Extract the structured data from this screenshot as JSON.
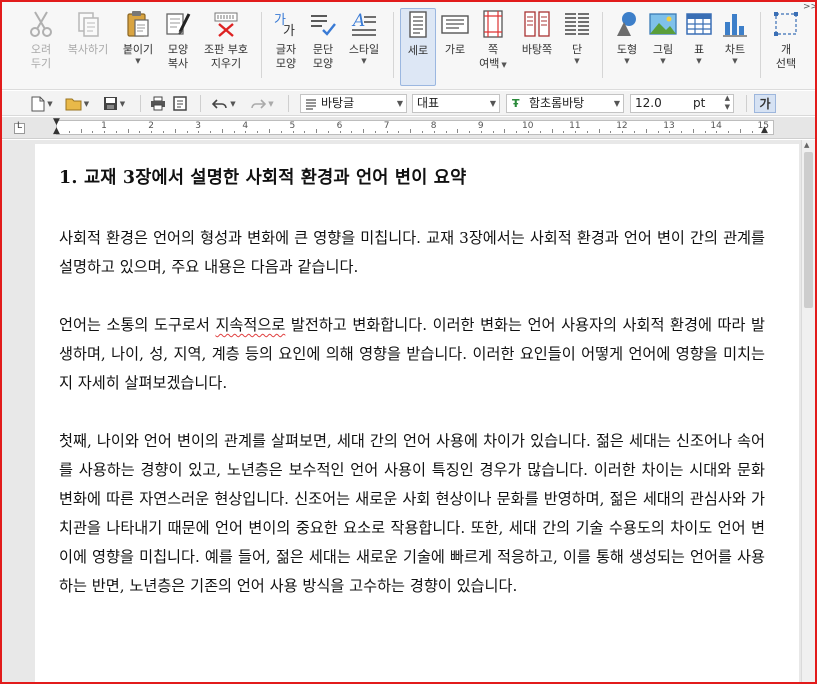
{
  "ribbon": {
    "cut": {
      "line1": "오려",
      "line2": "두기"
    },
    "copy": {
      "label": "복사하기"
    },
    "paste": {
      "label": "붙이기"
    },
    "format_copy": {
      "line1": "모양",
      "line2": "복사"
    },
    "clear_format": {
      "line1": "조판 부호",
      "line2": "지우기"
    },
    "char_shape": {
      "line1": "글자",
      "line2": "모양"
    },
    "para_shape": {
      "line1": "문단",
      "line2": "모양"
    },
    "style": {
      "label": "스타일"
    },
    "portrait": {
      "label": "세로"
    },
    "landscape": {
      "label": "가로"
    },
    "page_margin": {
      "line1": "쪽",
      "line2": "여백"
    },
    "page_border": {
      "label": "바탕쪽"
    },
    "columns": {
      "label": "단"
    },
    "shape": {
      "label": "도형"
    },
    "picture": {
      "label": "그림"
    },
    "table": {
      "label": "표"
    },
    "chart": {
      "label": "차트"
    },
    "object_select": {
      "line1": "개",
      "line2": "선택"
    }
  },
  "toolbar": {
    "style_font_box": "바탕글",
    "lang_box": "대표",
    "font_box": "함초롬바탕",
    "size_value": "12.0",
    "size_unit": "pt",
    "char_button": "가",
    "more": ">>"
  },
  "ruler": {
    "numbers": [
      "1",
      "2",
      "3",
      "4",
      "5",
      "6",
      "7",
      "8",
      "9",
      "10",
      "11",
      "12",
      "13",
      "14",
      "15"
    ]
  },
  "document": {
    "title": "1. 교재 3장에서 설명한 사회적 환경과 언어 변이 요약",
    "p1": "사회적 환경은 언어의 형성과 변화에 큰 영향을 미칩니다. 교재 3장에서는 사회적 환경과 언어 변이 간의 관계를 설명하고 있으며, 주요 내용은 다음과 같습니다.",
    "p2a": "언어는 소통의 도구로서 ",
    "p2_misspelled": "지속적으로",
    "p2b": " 발전하고 변화합니다. 이러한 변화는 언어 사용자의 사회적 환경에 따라 발생하며, 나이, 성, 지역, 계층 등의 요인에 의해 영향을 받습니다. 이러한 요인들이 어떻게 언어에 영향을 미치는지 자세히 살펴보겠습니다.",
    "p3": "첫째, 나이와 언어 변이의 관계를 살펴보면, 세대 간의 언어 사용에 차이가 있습니다. 젊은 세대는 신조어나 속어를 사용하는 경향이 있고, 노년층은 보수적인 언어 사용이 특징인 경우가 많습니다. 이러한 차이는 시대와 문화 변화에 따른 자연스러운 현상입니다. 신조어는 새로운 사회 현상이나 문화를 반영하며, 젊은 세대의 관심사와 가치관을 나타내기 때문에 언어 변이의 중요한 요소로 작용합니다. 또한, 세대 간의 기술 수용도의 차이도 언어 변이에 영향을 미칩니다. 예를 들어, 젊은 세대는 새로운 기술에 빠르게 적응하고, 이를 통해 생성되는 언어를 사용하는 반면, 노년층은 기존의 언어 사용 방식을 고수하는 경향이 있습니다."
  },
  "colors": {
    "frame_border": "#e21b1b",
    "selected_button_bg": "#dde7f5",
    "spell_error": "#e04040"
  }
}
